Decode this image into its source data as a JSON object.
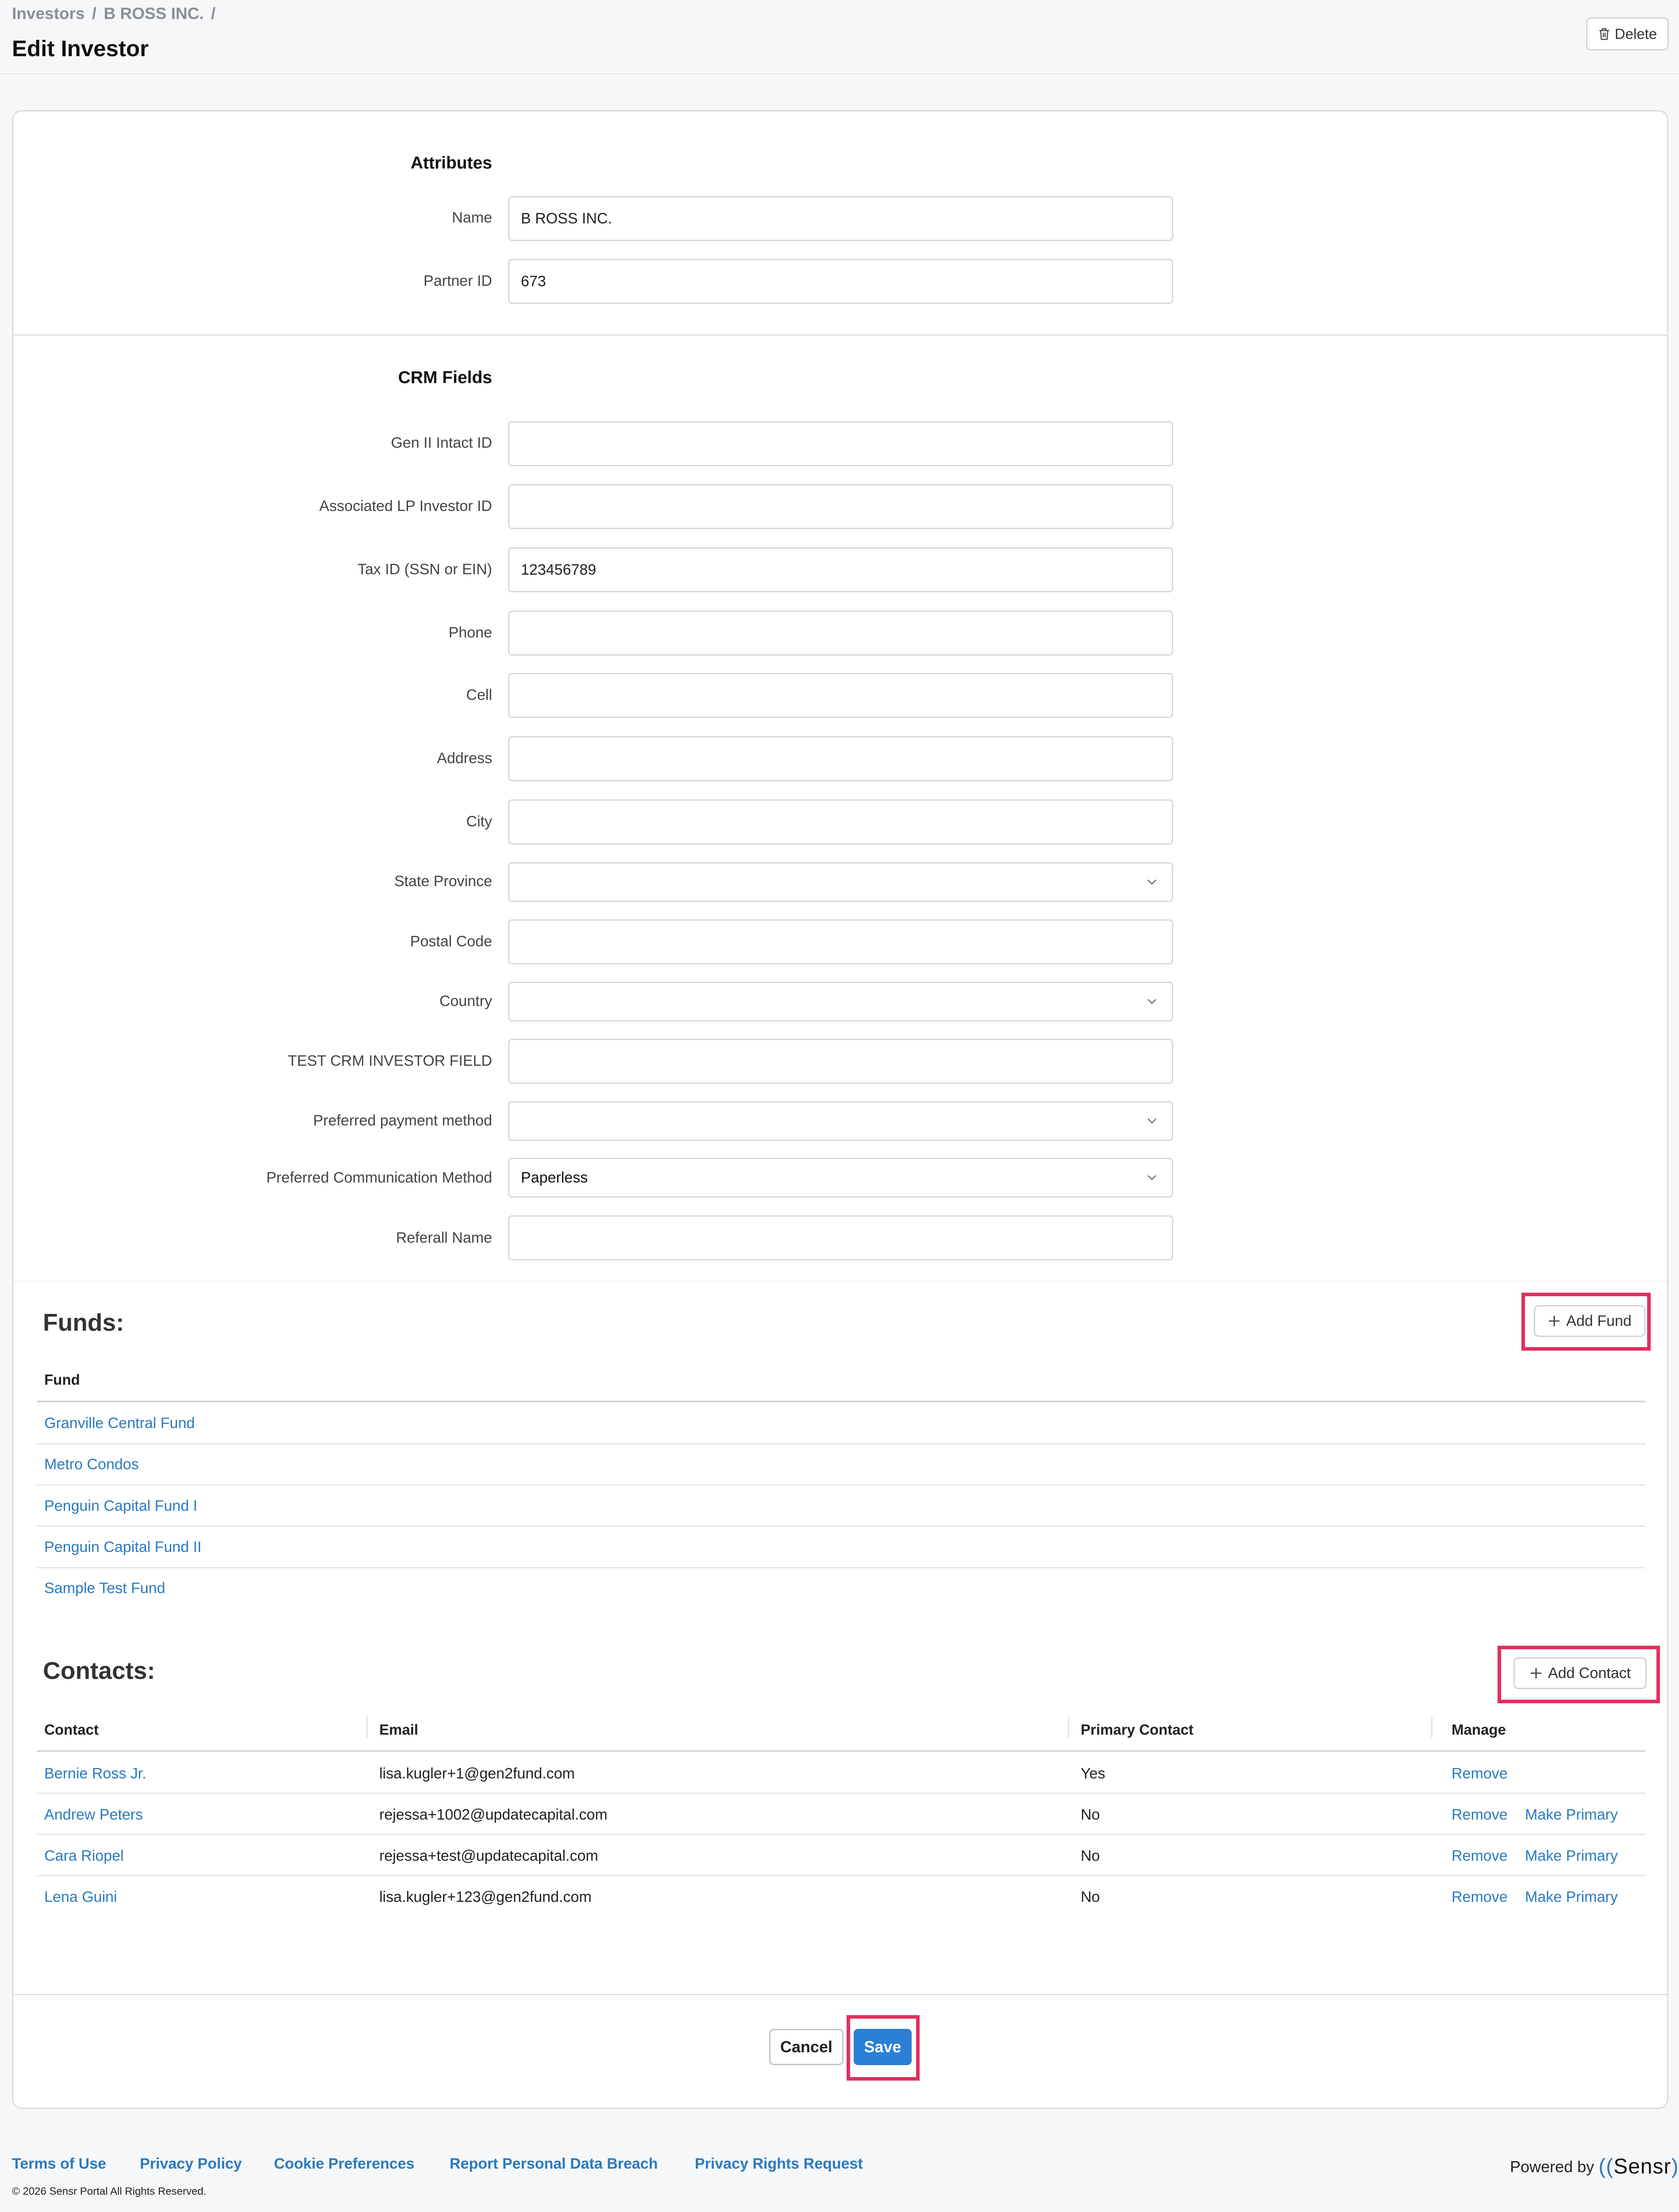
{
  "header": {
    "breadcrumb": [
      "Investors",
      "/",
      "B ROSS INC.",
      "/"
    ],
    "title": "Edit Investor",
    "delete_label": "Delete"
  },
  "attributes": {
    "title": "Attributes",
    "fields": [
      {
        "label": "Name",
        "value": "B ROSS INC."
      },
      {
        "label": "Partner ID",
        "value": "673"
      }
    ]
  },
  "crm": {
    "title": "CRM Fields",
    "fields": [
      {
        "label": "Gen II Intact ID",
        "type": "input",
        "value": ""
      },
      {
        "label": "Associated LP Investor ID",
        "type": "input",
        "value": ""
      },
      {
        "label": "Tax ID (SSN or EIN)",
        "type": "input",
        "value": "123456789"
      },
      {
        "label": "Phone",
        "type": "input",
        "value": ""
      },
      {
        "label": "Cell",
        "type": "input",
        "value": ""
      },
      {
        "label": "Address",
        "type": "input",
        "value": ""
      },
      {
        "label": "City",
        "type": "input",
        "value": ""
      },
      {
        "label": "State Province",
        "type": "select",
        "value": ""
      },
      {
        "label": "Postal Code",
        "type": "input",
        "value": ""
      },
      {
        "label": "Country",
        "type": "select",
        "value": ""
      },
      {
        "label": "TEST CRM INVESTOR FIELD",
        "type": "input",
        "value": ""
      },
      {
        "label": "Preferred payment method",
        "type": "select",
        "value": ""
      },
      {
        "label": "Preferred Communication Method",
        "type": "select",
        "value": "Paperless"
      },
      {
        "label": "Referall Name",
        "type": "input",
        "value": ""
      }
    ]
  },
  "funds": {
    "title": "Funds:",
    "add_label": "Add Fund",
    "column": "Fund",
    "items": [
      "Granville Central Fund",
      "Metro Condos",
      "Penguin Capital Fund I",
      "Penguin Capital Fund II",
      "Sample Test Fund"
    ]
  },
  "contacts": {
    "title": "Contacts:",
    "add_label": "Add Contact",
    "columns": [
      "Contact",
      "Email",
      "Primary Contact",
      "Manage"
    ],
    "remove_label": "Remove",
    "make_primary_label": "Make Primary",
    "rows": [
      {
        "name": "Bernie Ross Jr.",
        "email": "lisa.kugler+1@gen2fund.com",
        "primary": "Yes"
      },
      {
        "name": "Andrew Peters",
        "email": "rejessa+1002@updatecapital.com",
        "primary": "No"
      },
      {
        "name": "Cara Riopel",
        "email": "rejessa+test@updatecapital.com",
        "primary": "No"
      },
      {
        "name": "Lena Guini",
        "email": "lisa.kugler+123@gen2fund.com",
        "primary": "No"
      }
    ]
  },
  "actions": {
    "cancel": "Cancel",
    "save": "Save"
  },
  "footer": {
    "links": [
      "Terms of Use",
      "Privacy Policy",
      "Cookie Preferences",
      "Report Personal Data Breach",
      "Privacy Rights Request"
    ],
    "copyright": "© 2026 Sensr Portal All Rights Reserved.",
    "powered_by": "Powered by",
    "brand": "Sensr"
  },
  "colors": {
    "link": "#2a7ac0",
    "primary_button": "#2b7fd4",
    "highlight": "#e0305e"
  }
}
